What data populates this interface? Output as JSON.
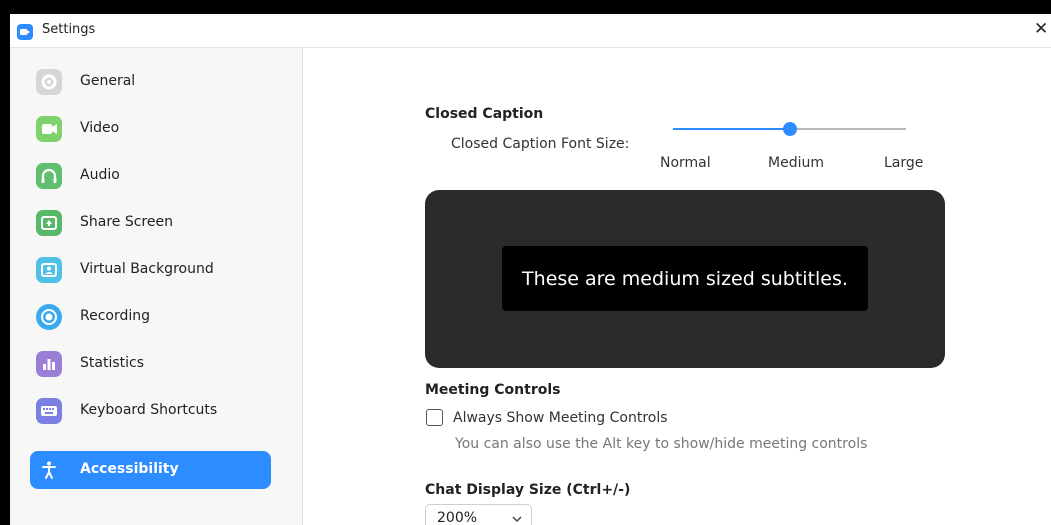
{
  "window": {
    "title": "Settings",
    "close_glyph": "✕",
    "app_icon": "zoom-video-icon"
  },
  "sidebar": {
    "items": [
      {
        "label": "General",
        "icon": "gear-icon",
        "color": "#d6d6d6",
        "active": false
      },
      {
        "label": "Video",
        "icon": "video-camera-icon",
        "color": "#7ed16b",
        "active": false
      },
      {
        "label": "Audio",
        "icon": "headphones-icon",
        "color": "#5fbf6e",
        "active": false
      },
      {
        "label": "Share Screen",
        "icon": "share-screen-icon",
        "color": "#58b86a",
        "active": false
      },
      {
        "label": "Virtual Background",
        "icon": "virtual-background-icon",
        "color": "#4fc0e8",
        "active": false
      },
      {
        "label": "Recording",
        "icon": "record-icon",
        "color": "#3aa9f0",
        "active": false
      },
      {
        "label": "Statistics",
        "icon": "bar-chart-icon",
        "color": "#9b7fd6",
        "active": false
      },
      {
        "label": "Keyboard Shortcuts",
        "icon": "keyboard-icon",
        "color": "#7b7fe3",
        "active": false
      },
      {
        "label": "Accessibility",
        "icon": "accessibility-person-icon",
        "color": "#2d8cff",
        "active": true
      }
    ]
  },
  "closed_caption": {
    "section_title": "Closed Caption",
    "font_size_label": "Closed Caption Font Size:",
    "slider_options": [
      "Normal",
      "Medium",
      "Large"
    ],
    "selected_option": "Medium",
    "selected_index": 1,
    "preview_text": "These are medium sized subtitles."
  },
  "meeting_controls": {
    "section_title": "Meeting Controls",
    "checkbox_label": "Always Show Meeting Controls",
    "checked": false,
    "hint": "You can also use the Alt key to show/hide meeting controls"
  },
  "chat_display": {
    "section_title": "Chat Display Size (Ctrl+/-)",
    "selected_value": "200%"
  },
  "colors": {
    "accent": "#2d8cff",
    "preview_background": "#2b2b2b",
    "subtitle_background": "#000000"
  }
}
